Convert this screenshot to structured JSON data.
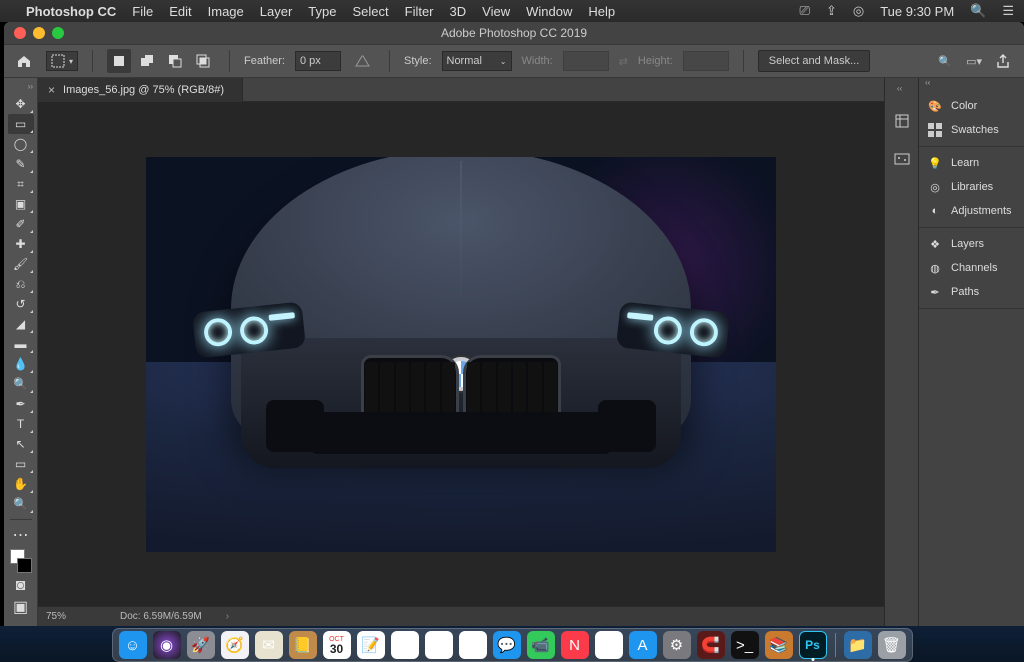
{
  "macos": {
    "app_name": "Photoshop CC",
    "menus": [
      "File",
      "Edit",
      "Image",
      "Layer",
      "Type",
      "Select",
      "Filter",
      "3D",
      "View",
      "Window",
      "Help"
    ],
    "clock": "Tue 9:30 PM"
  },
  "window": {
    "title": "Adobe Photoshop CC 2019"
  },
  "options_bar": {
    "feather_label": "Feather:",
    "feather_value": "0 px",
    "style_label": "Style:",
    "style_value": "Normal",
    "width_label": "Width:",
    "width_value": "",
    "height_label": "Height:",
    "height_value": "",
    "select_mask": "Select and Mask..."
  },
  "document": {
    "tab_label": "Images_56.jpg @ 75% (RGB/8#)"
  },
  "status_bar": {
    "zoom": "75%",
    "doc_info": "Doc: 6.59M/6.59M"
  },
  "right_panels": {
    "group1": [
      "Color",
      "Swatches"
    ],
    "group2": [
      "Learn",
      "Libraries",
      "Adjustments"
    ],
    "group3": [
      "Layers",
      "Channels",
      "Paths"
    ]
  },
  "left_tools": [
    {
      "name": "move-tool",
      "glyph": "✥"
    },
    {
      "name": "rectangular-marquee-tool",
      "glyph": "▭",
      "active": true
    },
    {
      "name": "lasso-tool",
      "glyph": "◯"
    },
    {
      "name": "quick-selection-tool",
      "glyph": "✎"
    },
    {
      "name": "crop-tool",
      "glyph": "⌗"
    },
    {
      "name": "frame-tool",
      "glyph": "▣"
    },
    {
      "name": "eyedropper-tool",
      "glyph": "✐"
    },
    {
      "name": "spot-healing-tool",
      "glyph": "✚"
    },
    {
      "name": "brush-tool",
      "glyph": "🖌"
    },
    {
      "name": "clone-stamp-tool",
      "glyph": "⎌"
    },
    {
      "name": "history-brush-tool",
      "glyph": "↺"
    },
    {
      "name": "eraser-tool",
      "glyph": "◢"
    },
    {
      "name": "gradient-tool",
      "glyph": "▬"
    },
    {
      "name": "blur-tool",
      "glyph": "💧"
    },
    {
      "name": "dodge-tool",
      "glyph": "🔍"
    },
    {
      "name": "pen-tool",
      "glyph": "✒"
    },
    {
      "name": "type-tool",
      "glyph": "T"
    },
    {
      "name": "path-selection-tool",
      "glyph": "↖"
    },
    {
      "name": "rectangle-tool",
      "glyph": "▭"
    },
    {
      "name": "hand-tool",
      "glyph": "✋"
    },
    {
      "name": "zoom-tool",
      "glyph": "🔍"
    }
  ],
  "dock": [
    {
      "name": "finder",
      "bg": "#1e96f0",
      "glyph": "☺"
    },
    {
      "name": "siri",
      "bg": "radial-gradient(circle,#8a4bd6,#1a1a1a)",
      "glyph": "◉"
    },
    {
      "name": "launchpad",
      "bg": "#8c8c94",
      "glyph": "🚀"
    },
    {
      "name": "safari",
      "bg": "#f2f2f7",
      "glyph": "🧭"
    },
    {
      "name": "mail",
      "bg": "#e7e2d0",
      "glyph": "✉"
    },
    {
      "name": "contacts",
      "bg": "#c08a4a",
      "glyph": "📒"
    },
    {
      "name": "calendar",
      "bg": "#fff",
      "glyph": "📅",
      "label": "30"
    },
    {
      "name": "notes",
      "bg": "#fff",
      "glyph": "📝"
    },
    {
      "name": "reminders",
      "bg": "#fff",
      "glyph": "☑"
    },
    {
      "name": "maps",
      "bg": "#fff",
      "glyph": "🗺"
    },
    {
      "name": "photos",
      "bg": "#fff",
      "glyph": "❃"
    },
    {
      "name": "messages",
      "bg": "#1e96f0",
      "glyph": "💬"
    },
    {
      "name": "facetime",
      "bg": "#33c95b",
      "glyph": "📹"
    },
    {
      "name": "news",
      "bg": "#fb3b4a",
      "glyph": "N"
    },
    {
      "name": "itunes",
      "bg": "#fff",
      "glyph": "♪"
    },
    {
      "name": "appstore",
      "bg": "#1e96f0",
      "glyph": "A"
    },
    {
      "name": "preferences",
      "bg": "#7a7a7e",
      "glyph": "⚙"
    },
    {
      "name": "magnet",
      "bg": "#5a1a1a",
      "glyph": "🧲"
    },
    {
      "name": "terminal",
      "bg": "#111",
      "glyph": ">_"
    },
    {
      "name": "books",
      "bg": "#c97a2e",
      "glyph": "📚"
    },
    {
      "name": "photoshop",
      "bg": "#001d26",
      "glyph": "Ps",
      "active": true
    },
    {
      "name": "downloads",
      "bg": "#2e6ca8",
      "glyph": "📁"
    },
    {
      "name": "trash",
      "bg": "#9aa0a6",
      "glyph": "🗑"
    }
  ]
}
